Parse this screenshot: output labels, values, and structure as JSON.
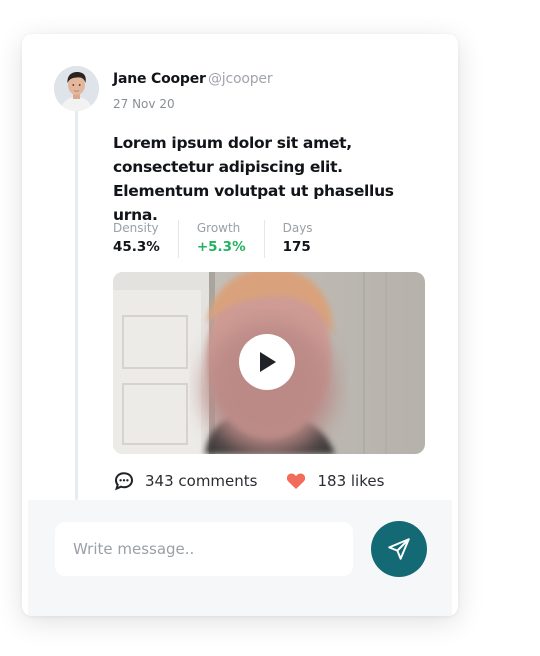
{
  "post": {
    "author": {
      "name": "Jane Cooper",
      "handle": "@jcooper",
      "date": "27 Nov 20"
    },
    "text": "Lorem ipsum dolor sit amet, consectetur adipiscing elit. Elementum volutpat ut phasellus urna.",
    "stats": [
      {
        "label": "Density",
        "value": "45.3%"
      },
      {
        "label": "Growth",
        "value": "+5.3%"
      },
      {
        "label": "Days",
        "value": "175"
      }
    ],
    "video": {
      "icon": "play-icon"
    },
    "actions": {
      "comments": {
        "icon": "comment-icon",
        "label": "343 comments"
      },
      "likes": {
        "icon": "heart-icon",
        "label": "183 likes"
      }
    }
  },
  "composer": {
    "placeholder": "Write message..",
    "send_icon": "send-icon"
  },
  "colors": {
    "accent": "#136a74",
    "positive": "#22b35e",
    "heart": "#f26b5b"
  }
}
